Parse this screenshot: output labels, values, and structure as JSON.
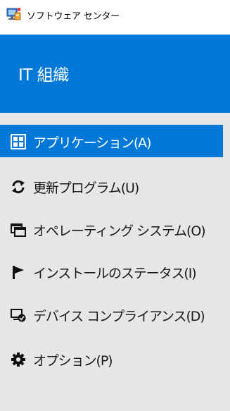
{
  "window": {
    "title": "ソフトウェア センター",
    "app_icon": "software-center-icon"
  },
  "header": {
    "organization": "IT 組織",
    "background_color": "#0078d7"
  },
  "sidebar": {
    "background_color": "#e6e6e6",
    "selected_color": "#0078d7",
    "items": [
      {
        "label": "アプリケーション(A)",
        "icon": "applications-icon",
        "selected": true
      },
      {
        "label": "更新プログラム(U)",
        "icon": "refresh-icon",
        "selected": false
      },
      {
        "label": "オペレーティング システム(O)",
        "icon": "windows-icon",
        "selected": false
      },
      {
        "label": "インストールのステータス(I)",
        "icon": "flag-icon",
        "selected": false
      },
      {
        "label": "デバイス コンプライアンス(D)",
        "icon": "device-compliance-icon",
        "selected": false
      },
      {
        "label": "オプション(P)",
        "icon": "gear-icon",
        "selected": false
      }
    ]
  }
}
